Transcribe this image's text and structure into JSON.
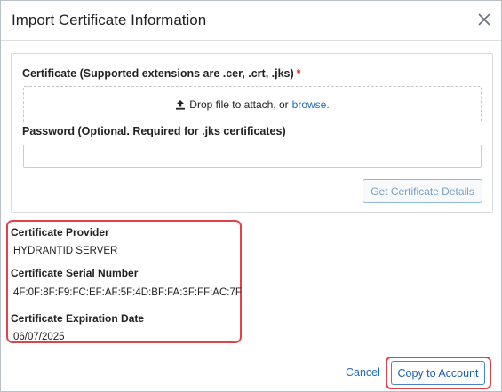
{
  "dialog": {
    "title": "Import Certificate Information",
    "close_icon": "close-icon"
  },
  "upload": {
    "certificate_label": "Certificate (Supported extensions are .cer, .crt, .jks)",
    "required_marker": "*",
    "drop_text": "Drop file to attach, or",
    "browse_link": "browse.",
    "upload_icon": "upload-icon",
    "password_label": "Password (Optional. Required for .jks certificates)",
    "password_value": "",
    "get_details_button": "Get Certificate Details"
  },
  "certificate": {
    "provider_label": "Certificate Provider",
    "provider_value": "HYDRANTID SERVER",
    "serial_label": "Certificate Serial Number",
    "serial_value": "4F:0F:8F:F9:FC:EF:AF:5F:4D:BF:FA:3F:FF:AC:7F",
    "expiration_label": "Certificate Expiration Date",
    "expiration_value": "06/07/2025"
  },
  "footer": {
    "cancel_label": "Cancel",
    "copy_label": "Copy to Account"
  },
  "colors": {
    "highlight": "#e2424c",
    "link": "#1e6bb8",
    "required": "#d6202e"
  }
}
